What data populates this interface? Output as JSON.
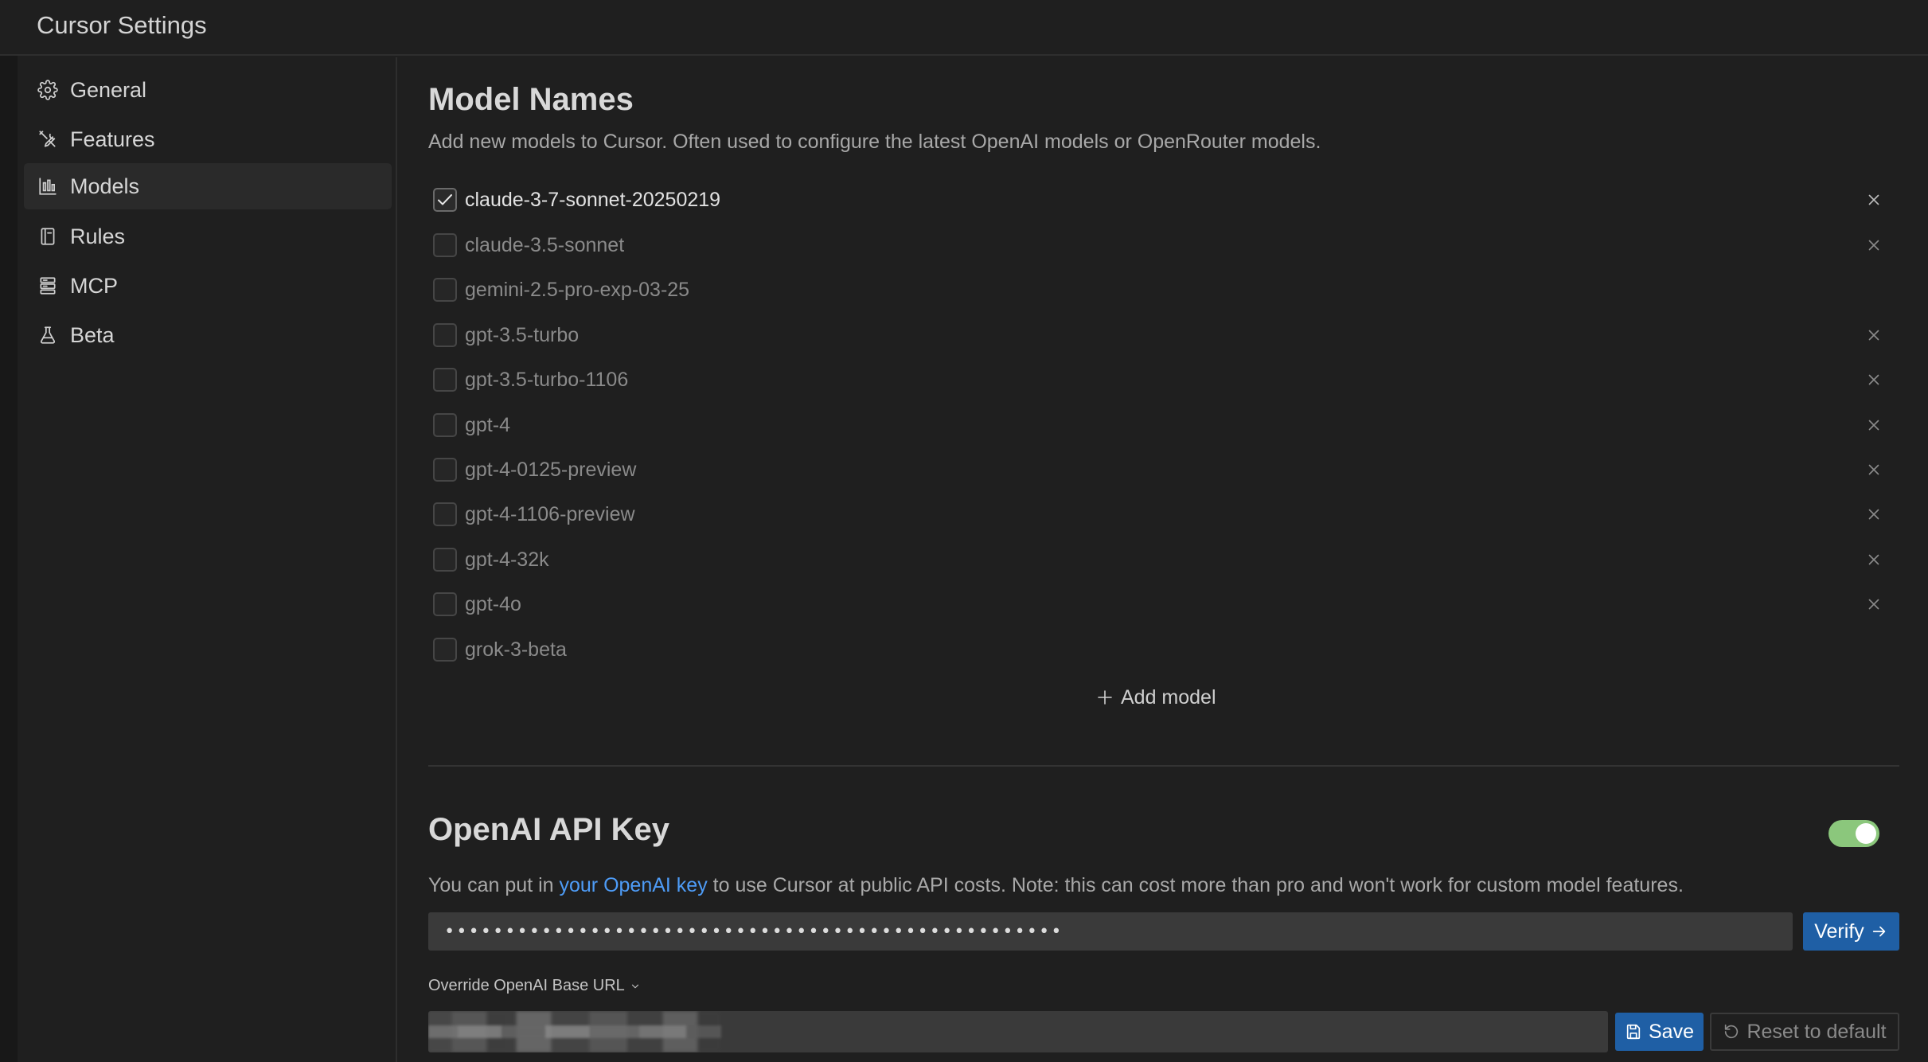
{
  "window": {
    "title": "Cursor Settings"
  },
  "sidebar": {
    "items": [
      {
        "label": "General",
        "icon": "gear-icon"
      },
      {
        "label": "Features",
        "icon": "tools-icon"
      },
      {
        "label": "Models",
        "icon": "bar-chart-icon",
        "active": true
      },
      {
        "label": "Rules",
        "icon": "book-icon"
      },
      {
        "label": "MCP",
        "icon": "server-icon"
      },
      {
        "label": "Beta",
        "icon": "flask-icon"
      }
    ]
  },
  "models_section": {
    "title": "Model Names",
    "description": "Add new models to Cursor. Often used to configure the latest OpenAI models or OpenRouter models.",
    "models": [
      {
        "name": "claude-3-7-sonnet-20250219",
        "checked": true,
        "removable": true
      },
      {
        "name": "claude-3.5-sonnet",
        "checked": false,
        "removable": true
      },
      {
        "name": "gemini-2.5-pro-exp-03-25",
        "checked": false,
        "removable": false
      },
      {
        "name": "gpt-3.5-turbo",
        "checked": false,
        "removable": true
      },
      {
        "name": "gpt-3.5-turbo-1106",
        "checked": false,
        "removable": true
      },
      {
        "name": "gpt-4",
        "checked": false,
        "removable": true
      },
      {
        "name": "gpt-4-0125-preview",
        "checked": false,
        "removable": true
      },
      {
        "name": "gpt-4-1106-preview",
        "checked": false,
        "removable": true
      },
      {
        "name": "gpt-4-32k",
        "checked": false,
        "removable": true
      },
      {
        "name": "gpt-4o",
        "checked": false,
        "removable": true
      },
      {
        "name": "grok-3-beta",
        "checked": false,
        "removable": false
      }
    ],
    "add_model_label": "Add model"
  },
  "openai_section": {
    "title": "OpenAI API Key",
    "toggle_on": true,
    "desc_prefix": "You can put in ",
    "desc_link": "your OpenAI key",
    "desc_suffix": " to use Cursor at public API costs. Note: this can cost more than pro and won't work for custom model features.",
    "api_key_masked": "•••••••••••••••••••••••••••••••••••••••••••••••••••",
    "verify_label": "Verify",
    "override_label": "Override OpenAI Base URL",
    "save_label": "Save",
    "reset_label": "Reset to default"
  },
  "colors": {
    "background": "#1f1f1f",
    "accent_blue": "#1f5fa5",
    "link_blue": "#4e9cf7",
    "toggle_green": "#8bc77c"
  }
}
